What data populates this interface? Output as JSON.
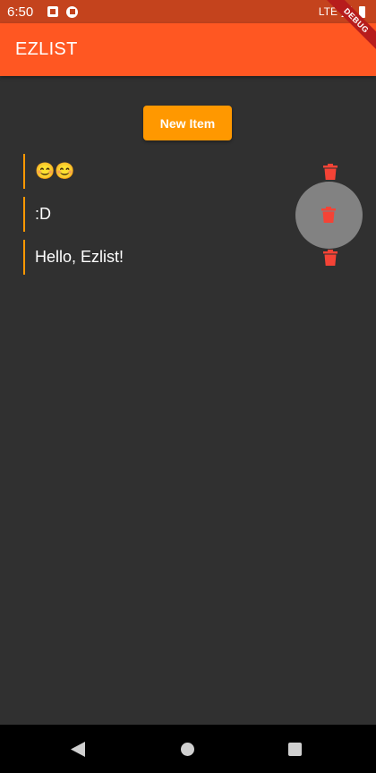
{
  "status_bar": {
    "time": "6:50",
    "network": "LTE"
  },
  "app_bar": {
    "title": "EZLIST"
  },
  "debug_banner": "DEBUG",
  "actions": {
    "new_item_label": "New Item"
  },
  "items": [
    {
      "text": "😊😊"
    },
    {
      "text": ":D"
    },
    {
      "text": "Hello, Ezlist!"
    }
  ],
  "colors": {
    "status_bar": "#c4431d",
    "app_bar": "#ff5722",
    "accent": "#ff9800",
    "delete": "#f44336",
    "background": "#303030",
    "debug_ribbon": "#b71c1c"
  },
  "icons": {
    "delete": "trash-can-icon",
    "nav_back": "back-triangle-icon",
    "nav_home": "home-circle-icon",
    "nav_recent": "recent-square-icon"
  }
}
